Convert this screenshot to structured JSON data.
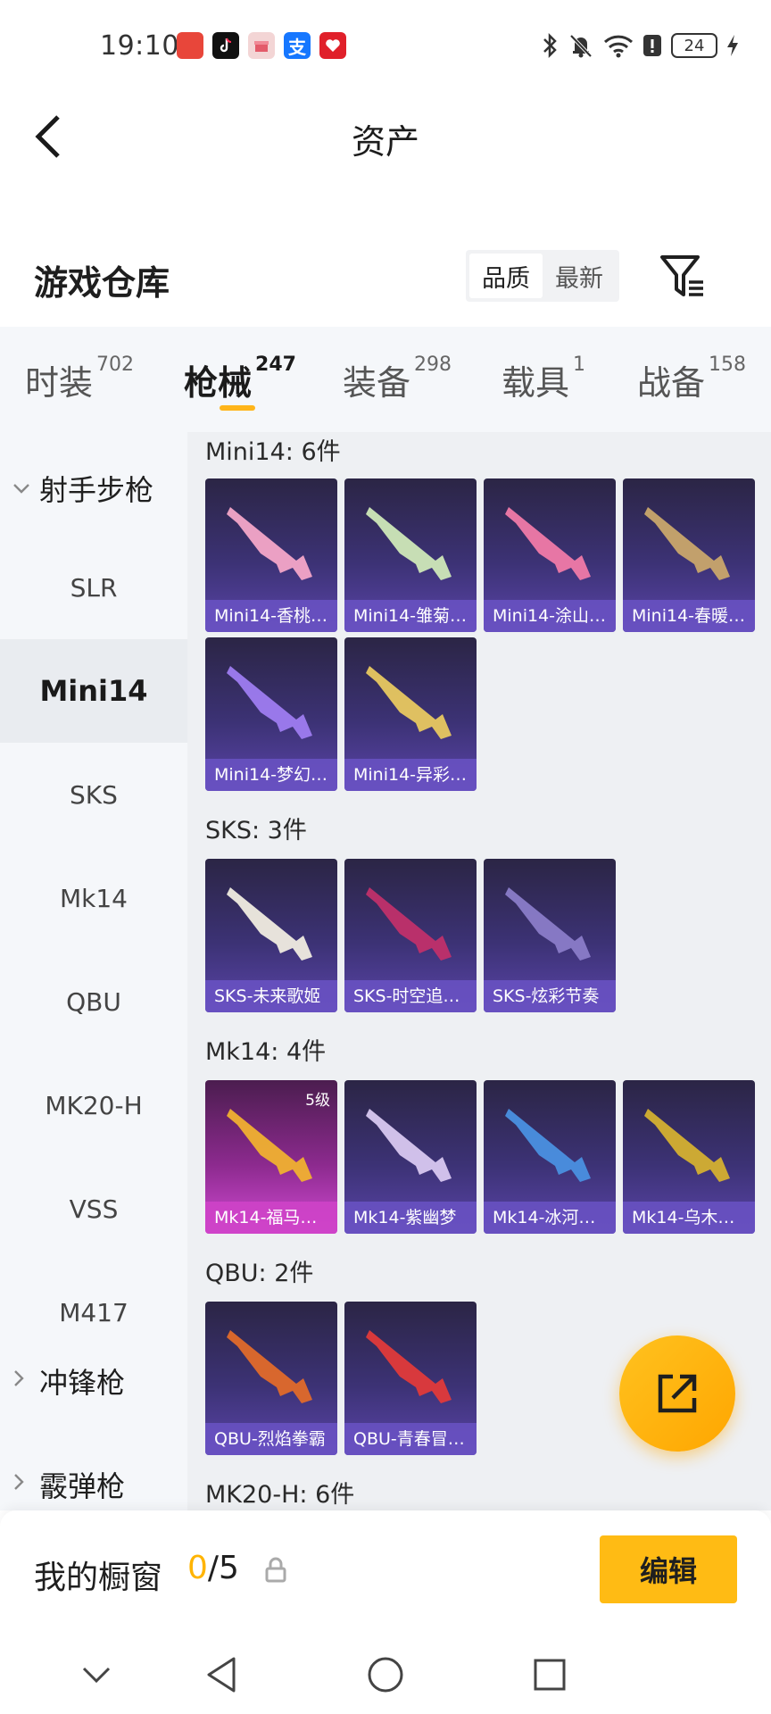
{
  "status_bar": {
    "time": "19:10",
    "apps": [
      {
        "icon": "huawei-app-icon",
        "color": "#e8463a",
        "text": ""
      },
      {
        "icon": "tiktok-app-icon",
        "color": "#111111",
        "text": ""
      },
      {
        "icon": "gift-app-icon",
        "color": "#f3d5d5",
        "text": ""
      },
      {
        "icon": "alipay-app-icon",
        "color": "#1677ff",
        "text": "支"
      },
      {
        "icon": "heart-app-icon",
        "color": "#e0202a",
        "text": ""
      }
    ],
    "battery": "24"
  },
  "header": {
    "title": "资产"
  },
  "warehouse": {
    "title": "游戏仓库",
    "sort_options": [
      "品质",
      "最新"
    ],
    "active_sort": "品质"
  },
  "tabs": [
    {
      "label": "时装",
      "count": "702"
    },
    {
      "label": "枪械",
      "count": "247"
    },
    {
      "label": "装备",
      "count": "298"
    },
    {
      "label": "载具",
      "count": "1"
    },
    {
      "label": "战备",
      "count": "158"
    }
  ],
  "sidebar": {
    "group_open": "射手步枪",
    "items": [
      "SLR",
      "Mini14",
      "SKS",
      "Mk14",
      "QBU",
      "MK20-H",
      "VSS",
      "M417"
    ],
    "active_item": "Mini14",
    "group_closed": "冲锋枪",
    "group_partial": "霰弹枪"
  },
  "sections": [
    {
      "title": "Mini14: 6件",
      "items": [
        {
          "name": "Mini14-香桃…",
          "color": "#f4a6c8"
        },
        {
          "name": "Mini14-雏菊…",
          "color": "#cfe8b8"
        },
        {
          "name": "Mini14-涂山…",
          "color": "#f07aa8"
        },
        {
          "name": "Mini14-春暖…",
          "color": "#c9a66b"
        },
        {
          "name": "Mini14-梦幻…",
          "color": "#9e7cf0"
        },
        {
          "name": "Mini14-异彩…",
          "color": "#e8c860"
        }
      ]
    },
    {
      "title": "SKS: 3件",
      "items": [
        {
          "name": "SKS-未来歌姬",
          "color": "#f0ece0"
        },
        {
          "name": "SKS-时空追…",
          "color": "#c0306a"
        },
        {
          "name": "SKS-炫彩节奏",
          "color": "#8a7cc8"
        }
      ]
    },
    {
      "title": "Mk14: 4件",
      "items": [
        {
          "name": "Mk14-福马…",
          "color": "#f0b030",
          "level": "5级"
        },
        {
          "name": "Mk14-紫幽梦",
          "color": "#d8c8f0"
        },
        {
          "name": "Mk14-冰河…",
          "color": "#4a90e0"
        },
        {
          "name": "Mk14-乌木…",
          "color": "#d4b030"
        }
      ]
    },
    {
      "title": "QBU: 2件",
      "items": [
        {
          "name": "QBU-烈焰拳霸",
          "color": "#e06a2a"
        },
        {
          "name": "QBU-青春冒…",
          "color": "#e03a3a"
        }
      ]
    },
    {
      "title": "MK20-H: 6件",
      "items": []
    }
  ],
  "showcase": {
    "title": "我的橱窗",
    "current": "0",
    "total": "/5",
    "edit_label": "编辑"
  }
}
